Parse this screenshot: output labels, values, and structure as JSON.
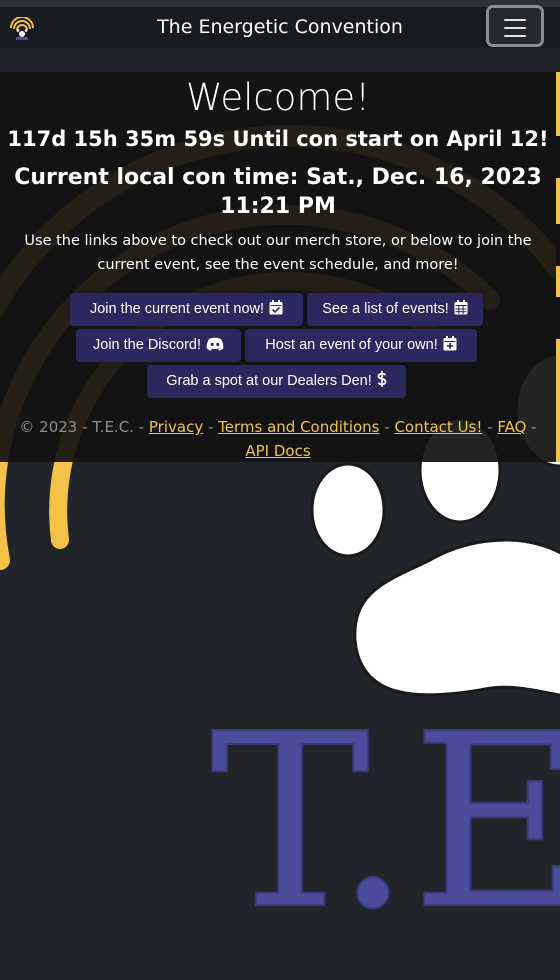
{
  "navbar": {
    "brand": "The Energetic Convention",
    "logo_icon": "tec-logo-icon",
    "menu_icon": "hamburger-menu-icon"
  },
  "background": {
    "watermark_text": "T.E",
    "paw_icon": "paw-print-icon"
  },
  "welcome": {
    "title": "Welcome!",
    "countdown": "117d 15h 35m 59s Until con start on April 12!",
    "local_time": "Current local con time: Sat., Dec. 16, 2023 11:21 PM",
    "intro": "Use the links above to check out our merch store, or below to join the current event, see the event schedule, and more!"
  },
  "buttons": [
    {
      "label": "Join the current event now!",
      "icon": "calendar-check-icon"
    },
    {
      "label": "See a list of events!",
      "icon": "calendar-grid-icon"
    },
    {
      "label": "Join the Discord!",
      "icon": "discord-icon"
    },
    {
      "label": "Host an event of your own!",
      "icon": "calendar-plus-icon"
    },
    {
      "label": "Grab a spot at our Dealers Den!",
      "icon": "dollar-icon"
    }
  ],
  "footer": {
    "copyright": "© 2023 - T.E.C. - ",
    "sep": " - ",
    "links": [
      "Privacy",
      "Terms and Conditions",
      "Contact Us!",
      "FAQ",
      "API Docs"
    ]
  },
  "colors": {
    "page_bg": "#212529",
    "navbar_bg": "#181b1e",
    "panel_bg": "#121212",
    "button_bg": "#2b2860",
    "accent_yellow": "#f3c246",
    "link_yellow": "#f1c645",
    "watermark_blue": "#4d4c9c"
  }
}
